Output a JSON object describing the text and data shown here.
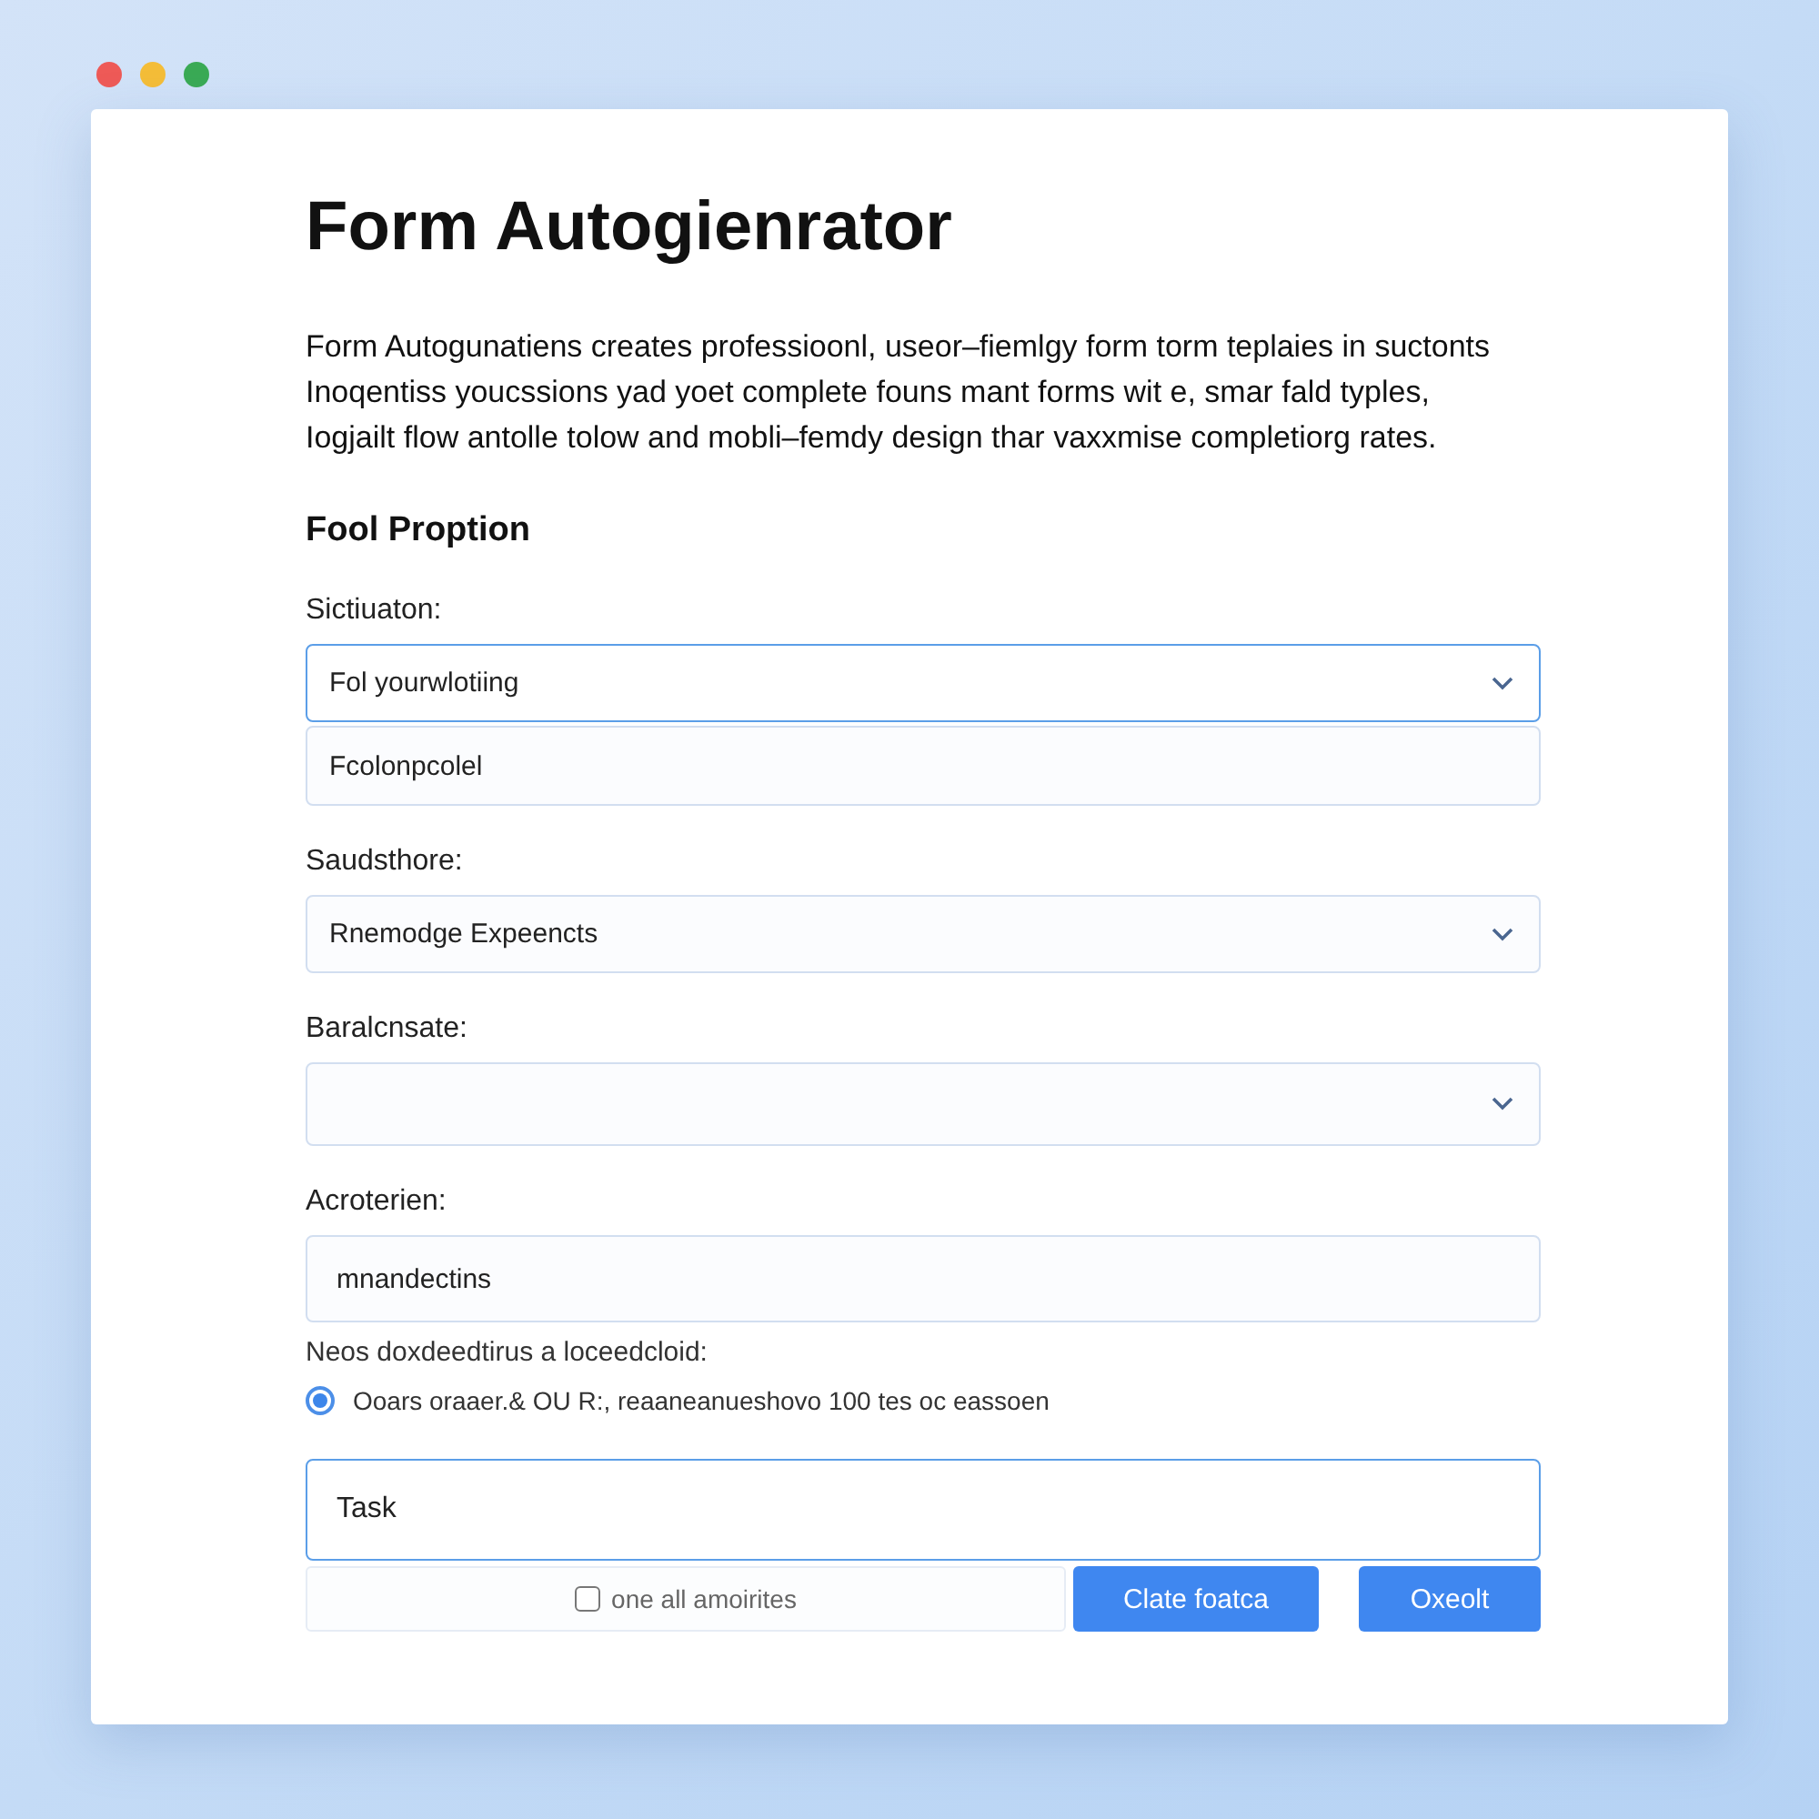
{
  "window": {
    "controls": [
      {
        "color": "#ee5a57"
      },
      {
        "color": "#f4bd38"
      },
      {
        "color": "#3aaa55"
      }
    ]
  },
  "title": "Form Autogienrator",
  "description": [
    "Form Autogunatiens creates professioonl, useor–fiemlgy form torm teplaies in suctonts",
    "Inoqentiss youcssions yad yoet complete founs mant forms wit e, smar fald typles,",
    "Iogjailt flow  antolle tolow and mobli–femdy design thar vaxxmise completiorg rates."
  ],
  "section": "Fool Proption",
  "fields": [
    {
      "kind": "select",
      "label": "Sictiuaton:",
      "value": "Fol yourwlotiing",
      "focused": true
    },
    {
      "kind": "menu",
      "value": "Fcolonpcolel",
      "focused": false
    },
    {
      "kind": "select",
      "label": "Saudsthore:",
      "value": "Rnemodge Expeencts",
      "focused": false
    },
    {
      "kind": "select",
      "label": "Baralcnsate:",
      "focused": false
    },
    {
      "kind": "text",
      "label": "Acroterien:",
      "value": "mnandectins",
      "focused": false
    }
  ],
  "hint": "Neos doxdeedtirus a loceedcloid:",
  "radio": {
    "label": "Ooars  oraaer.& OU R:, reaaneanueshovo  100 tes oc eassoen",
    "selected": true
  },
  "task": {
    "value": "Task",
    "focused": true
  },
  "checkbox": {
    "label": "one all  amoirites",
    "checked": false
  },
  "buttons": [
    "Clate foatca",
    "Oxeolt"
  ]
}
